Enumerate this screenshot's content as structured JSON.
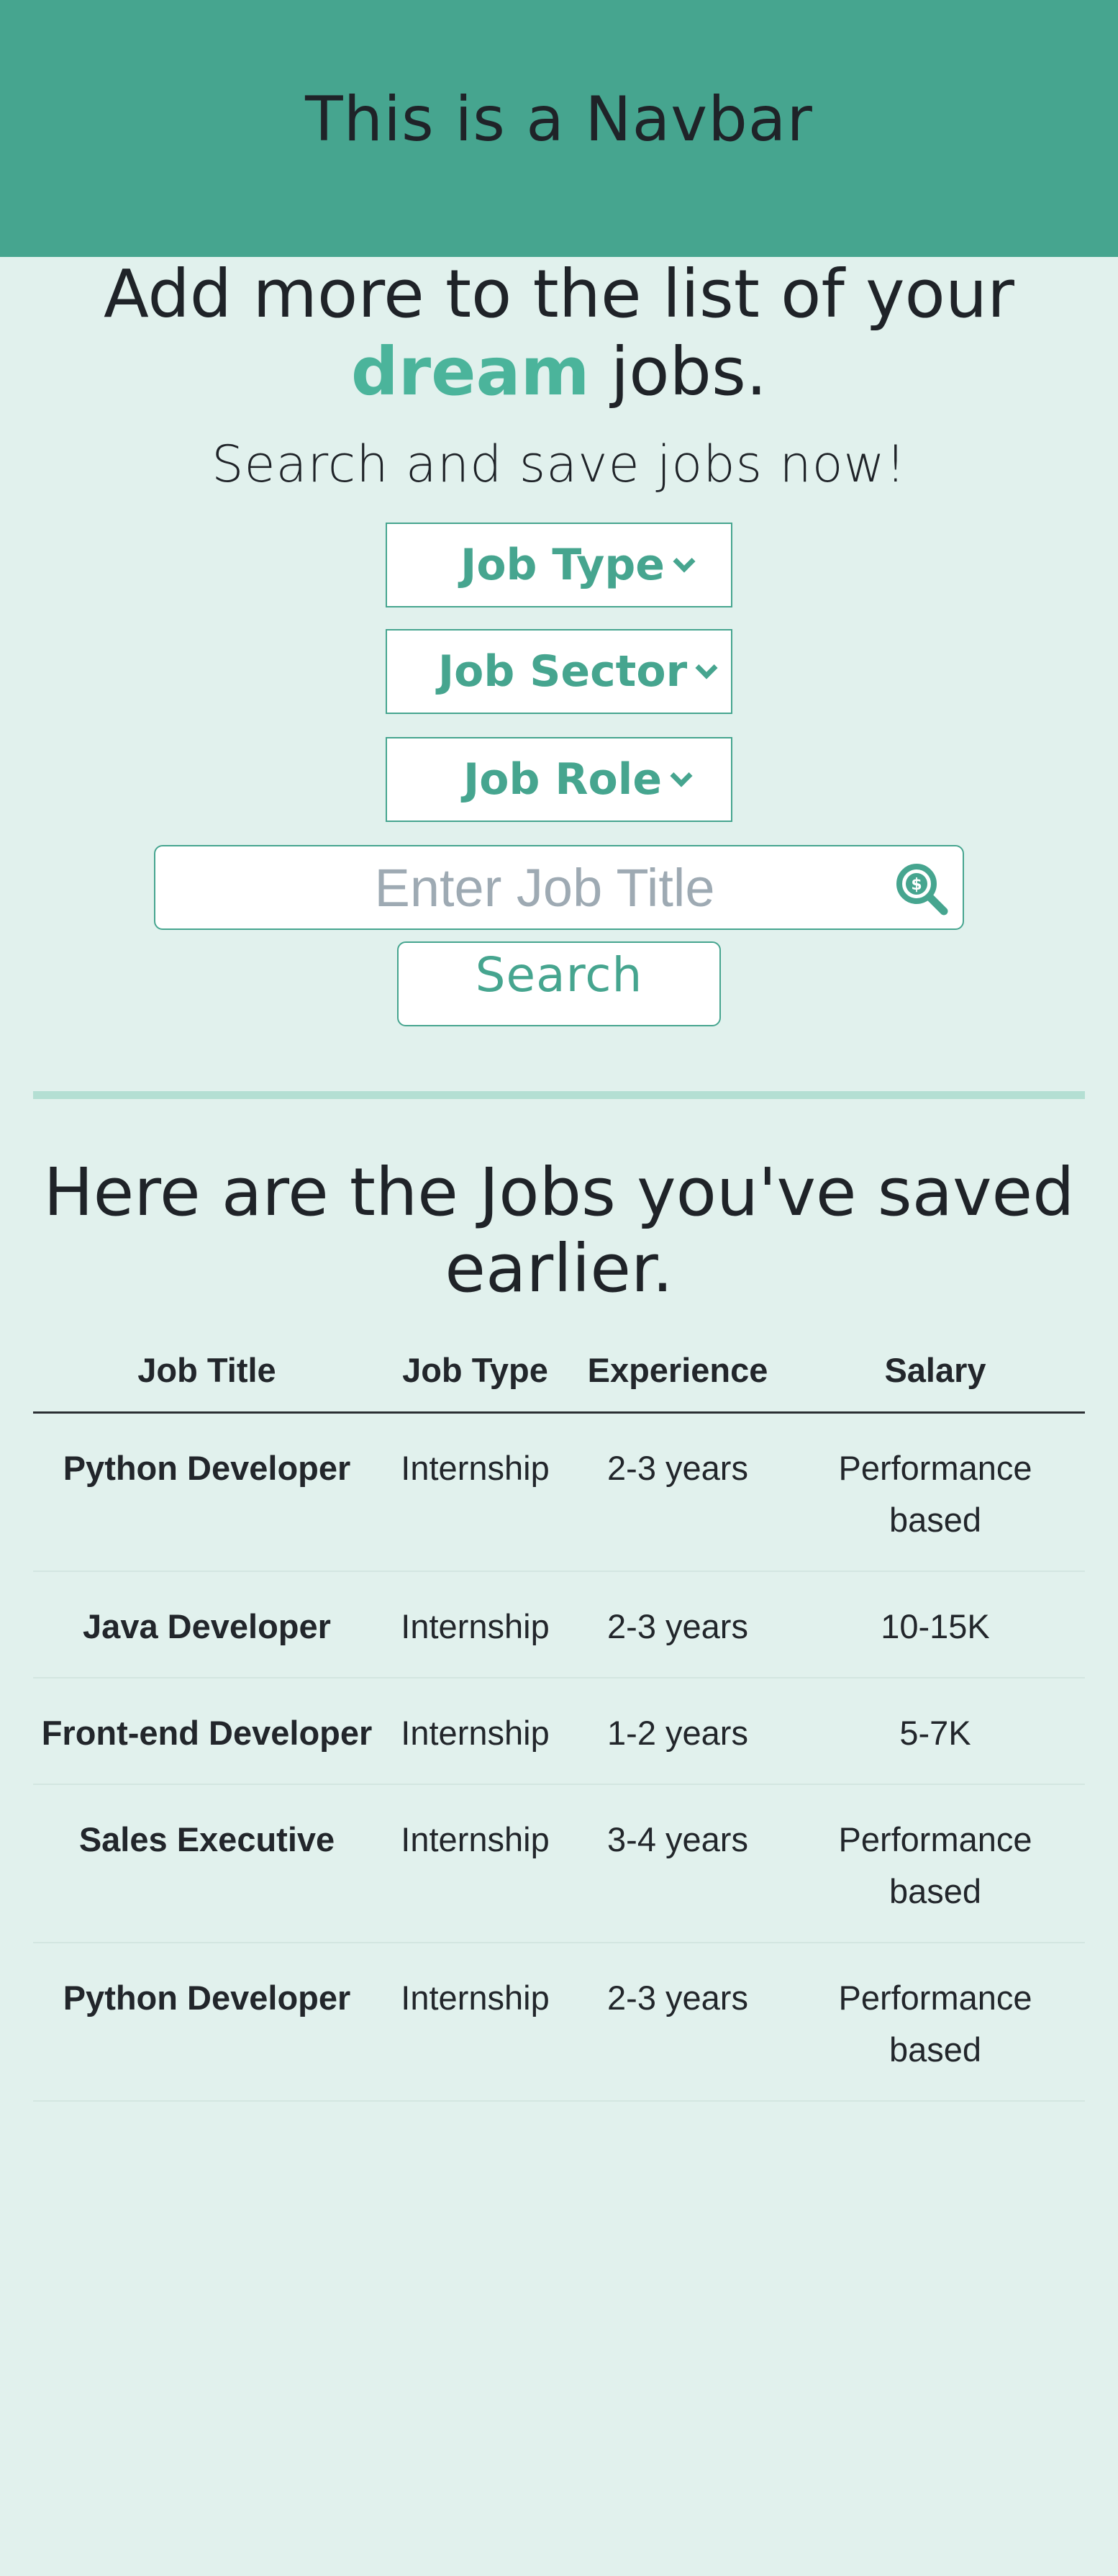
{
  "navbar": {
    "title": "This is a Navbar"
  },
  "hero": {
    "heading_before": "Add more to the list of your",
    "heading_accent": "dream",
    "heading_after": "jobs.",
    "subheading": "Search and save jobs now!"
  },
  "filters": {
    "job_type_label": "Job Type",
    "job_sector_label": "Job Sector",
    "job_role_label": "Job Role"
  },
  "search": {
    "placeholder": "Enter Job Title",
    "value": "",
    "button_label": "Search",
    "icon": "search-dollar-icon"
  },
  "saved": {
    "heading": "Here are the Jobs you've saved earlier.",
    "columns": [
      "Job Title",
      "Job Type",
      "Experience",
      "Salary"
    ],
    "rows": [
      [
        "Python Developer",
        "Internship",
        "2-3 years",
        "Performance based"
      ],
      [
        "Java Developer",
        "Internship",
        "2-3 years",
        "10-15K"
      ],
      [
        "Front-end Developer",
        "Internship",
        "1-2 years",
        "5-7K"
      ],
      [
        "Sales Executive",
        "Internship",
        "3-4 years",
        "Performance based"
      ],
      [
        "Python Developer",
        "Internship",
        "2-3 years",
        "Performance based"
      ]
    ]
  },
  "colors": {
    "accent": "#46a58f",
    "accent_light": "#4bb49b",
    "background": "#e1f1ed",
    "divider": "#b4dfd3",
    "text": "#1f2328"
  }
}
